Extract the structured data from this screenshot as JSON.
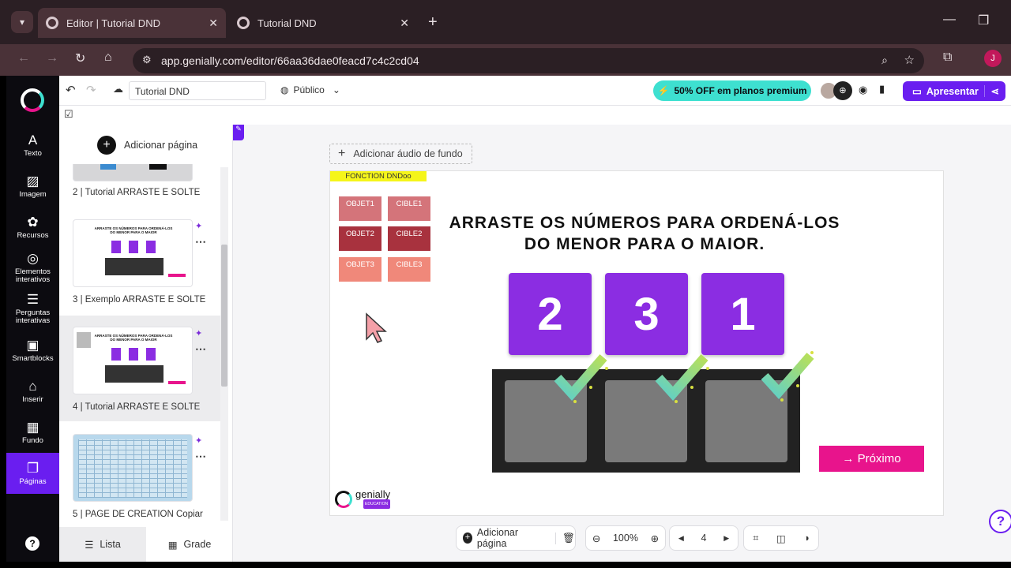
{
  "browser": {
    "tabs": [
      {
        "label": "Editor | Tutorial DND",
        "close": "✕"
      },
      {
        "label": "Tutorial DND",
        "close": "✕"
      }
    ],
    "new_tab": "+",
    "url": "app.genially.com/editor/66aa36dae0feacd7c4c2cd04",
    "profile_initial": "J"
  },
  "rail": {
    "items": [
      {
        "label": "Texto",
        "icon": "A"
      },
      {
        "label": "Imagem",
        "icon": "▨"
      },
      {
        "label": "Recursos",
        "icon": "✿"
      },
      {
        "label1": "Elementos",
        "label2": "interativos",
        "icon": "◎"
      },
      {
        "label1": "Perguntas",
        "label2": "interativas",
        "icon": "☰"
      },
      {
        "label": "Smartblocks",
        "icon": "▣"
      },
      {
        "label": "Inserir",
        "icon": "⌂"
      },
      {
        "label": "Fundo",
        "icon": "▦"
      },
      {
        "label": "Páginas",
        "icon": "❐"
      }
    ],
    "help": "?"
  },
  "topbar": {
    "title": "Tutorial DND",
    "visibility": "Público",
    "promo": "50% OFF em planos premium",
    "present": "Apresentar"
  },
  "panel": {
    "add_page": "Adicionar página",
    "pages": [
      {
        "label": "2 |  Tutorial ARRASTE E SOLTE"
      },
      {
        "label": "3 |  Exemplo ARRASTE E SOLTE"
      },
      {
        "label": "4 |  Tutorial ARRASTE E SOLTE"
      },
      {
        "label": "5 |  PAGE DE CREATION Copiar"
      }
    ],
    "thumb_text": "ARRASTE OS NÚMEROS PARA ORDENÁ-LOS DO MENOR PARA O MAIOR",
    "view_list": "Lista",
    "view_grid": "Grade"
  },
  "canvas": {
    "add_audio": "Adicionar áudio de fundo",
    "fonction_tag": "FONCTION DNDoo",
    "tags": [
      "OBJET1",
      "CIBLE1",
      "OBJET2",
      "CIBLE2",
      "OBJET3",
      "CIBLE3"
    ],
    "heading_line1": "ARRASTE OS NÚMEROS PARA ORDENÁ-LOS",
    "heading_line2": "DO MENOR PARA O MAIOR.",
    "numbers": [
      "2",
      "3",
      "1"
    ],
    "next_button": "→  Próximo",
    "logo": "genially",
    "logo_sub": "EDUCATION"
  },
  "bottombar": {
    "add_page": "Adicionar página",
    "zoom": "100%",
    "page": "4"
  },
  "colors": {
    "accent": "#6a1ef0",
    "purple_tile": "#8b2de2",
    "promo_bg": "#3ee0d0",
    "next_button": "#e8148c",
    "tag_yellow": "#f5f51a"
  }
}
